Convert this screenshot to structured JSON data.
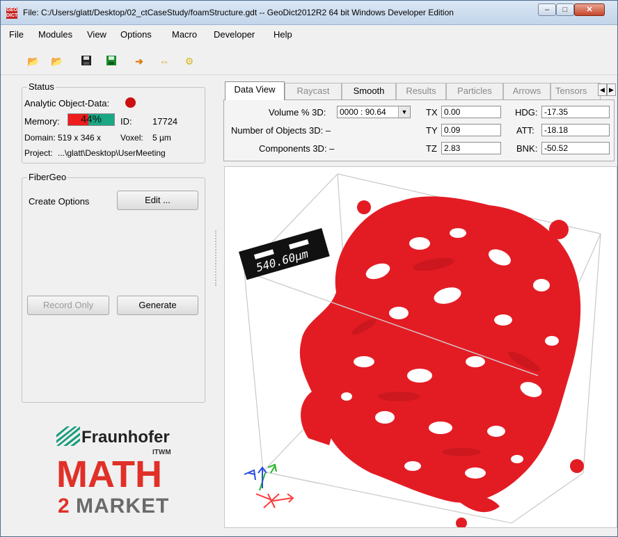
{
  "window": {
    "title": "File: C:/Users/glatt/Desktop/02_ctCaseStudy/foamStructure.gdt  --  GeoDict2012R2 64 bit Windows Developer Edition",
    "app_icon_text": "GEO\nDICT",
    "controls": [
      "minimize",
      "maximize",
      "close"
    ]
  },
  "menu": [
    "File",
    "Modules",
    "View",
    "Options",
    "Macro",
    "Developer",
    "Help"
  ],
  "toolbar": [
    "open-folder-icon",
    "open-folder-icon",
    "save-icon",
    "save-as-icon",
    "arrow-right-icon",
    "arrows-left-right-icon",
    "gear-icon"
  ],
  "status": {
    "title": "Status",
    "analytic_label": "Analytic Object-Data:",
    "analytic_color": "#d01010",
    "memory_label": "Memory:",
    "memory_value": "44%",
    "memory_fraction": 0.44,
    "id_label": "ID:",
    "id_value": "17724",
    "domain_label": "Domain:",
    "domain_value": "519 x 346 x",
    "voxel_label": "Voxel:",
    "voxel_value": "5 µm",
    "project_label": "Project:",
    "project_value": "...\\glatt\\Desktop\\UserMeeting"
  },
  "fibergeo": {
    "title": "FiberGeo",
    "create_options_label": "Create Options",
    "edit_label": "Edit ...",
    "record_only_label": "Record Only",
    "generate_label": "Generate"
  },
  "tabs": [
    "Data View",
    "Raycast",
    "Smooth",
    "Results",
    "Particles",
    "Arrows",
    "Tensors"
  ],
  "dataview": {
    "volume_label": "Volume % 3D:",
    "volume_value": "0000 : 90.64",
    "objects_label": "Number of Objects 3D: –",
    "components_label": "Components 3D: –",
    "tx_label": "TX",
    "tx_value": "0.00",
    "ty_label": "TY",
    "ty_value": "0.09",
    "tz_label": "TZ",
    "tz_value": "2.83",
    "hdg_label": "HDG:",
    "hdg_value": "-17.35",
    "att_label": "ATT:",
    "att_value": "-18.18",
    "bnk_label": "BNK:",
    "bnk_value": "-50.52"
  },
  "viewport": {
    "scale_label": "540.60µm",
    "foam_color": "#e31c24",
    "axes_colors": {
      "x": "#ff3a3a",
      "y": "#22b522",
      "z": "#2b4de0"
    }
  },
  "branding": {
    "fraunhofer": "Fraunhofer",
    "itwm": "ITWM",
    "math": "MATH",
    "two": "2",
    "market": "MARKET",
    "fraunhofer_green": "#179c7d",
    "math_red": "#e03028",
    "market_gray": "#6a6a6a"
  }
}
